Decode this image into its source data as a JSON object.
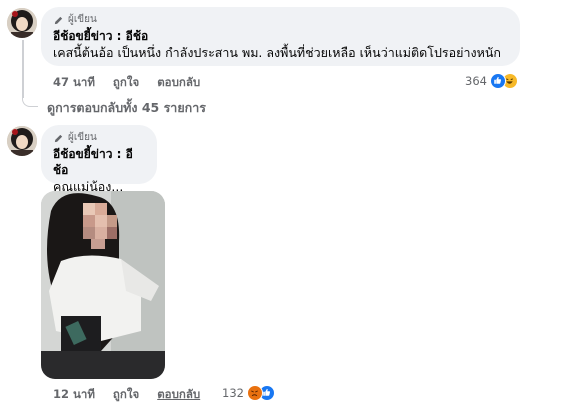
{
  "comment1": {
    "badge_label": "ผู้เขียน",
    "author": "อีช้อขยี้ข่าว : อีช้อ",
    "text": "เคสนี้ต้นอ้อ เป็นหนึ่ง กำลังประสาน พม. ลงพื้นที่ช่วยเหลือ เห็นว่าแม่ติดโปรอย่างหนัก",
    "time": "47 นาที",
    "like_label": "ถูกใจ",
    "reply_label": "ตอบกลับ",
    "reaction_count": "364",
    "reactions": [
      "like-icon",
      "haha-icon"
    ]
  },
  "replies_link": "ดูการตอบกลับทั้ง 45 รายการ",
  "comment2": {
    "badge_label": "ผู้เขียน",
    "author": "อีช้อขยี้ข่าว : อีช้อ",
    "text": "คุณแม่น้อง...",
    "time": "12 นาที",
    "like_label": "ถูกใจ",
    "reply_label": "ตอบกลับ",
    "reaction_count": "132",
    "reactions": [
      "angry-icon",
      "like-icon"
    ]
  },
  "colors": {
    "bubble": "#f0f2f5",
    "meta_text": "#65676b",
    "like_blue": "#1877f2",
    "angry_orange": "#e9710f"
  }
}
